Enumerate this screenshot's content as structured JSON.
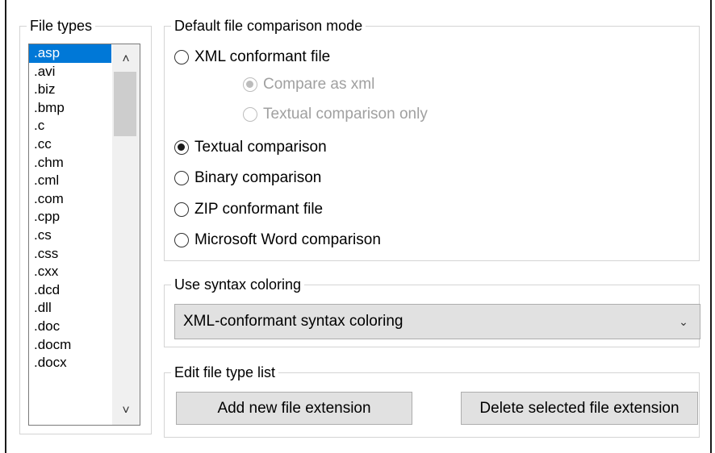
{
  "file_types": {
    "legend": "File types",
    "items": [
      ".asp",
      ".avi",
      ".biz",
      ".bmp",
      ".c",
      ".cc",
      ".chm",
      ".cml",
      ".com",
      ".cpp",
      ".cs",
      ".css",
      ".cxx",
      ".dcd",
      ".dll",
      ".doc",
      ".docm",
      ".docx"
    ],
    "selected": ".asp"
  },
  "comparison_mode": {
    "legend": "Default file comparison mode",
    "xml_conformant": "XML conformant file",
    "compare_as_xml": "Compare as xml",
    "textual_only": "Textual comparison only",
    "textual": "Textual comparison",
    "binary": "Binary comparison",
    "zip": "ZIP conformant file",
    "word": "Microsoft Word comparison",
    "selected": "Textual comparison"
  },
  "syntax_coloring": {
    "legend": "Use syntax coloring",
    "selected_value": "XML-conformant syntax coloring"
  },
  "edit_list": {
    "legend": "Edit file type list",
    "add_label": "Add new file extension",
    "delete_label": "Delete selected file extension"
  },
  "colors": {
    "selection": "#0078d7",
    "button_face": "#e1e1e1",
    "disabled_text": "#a0a0a0"
  }
}
